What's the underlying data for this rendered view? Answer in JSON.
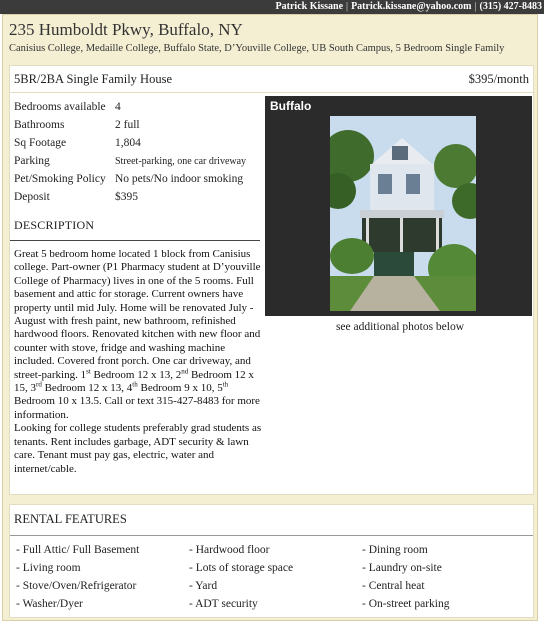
{
  "contact": {
    "name": "Patrick Kissane",
    "email": "Patrick.kissane@yahoo.com",
    "phone": "(315) 427-8483"
  },
  "listing": {
    "title": "235 Humboldt Pkwy, Buffalo, NY",
    "subtitle": "Canisius College, Medaille College, Buffalo State, D’Youville College, UB South Campus,  5 Bedroom Single Family",
    "summary": "5BR/2BA Single Family House",
    "rent": "$395/month"
  },
  "details": [
    {
      "label": "Bedrooms available",
      "value": "4"
    },
    {
      "label": "Bathrooms",
      "value": "2 full"
    },
    {
      "label": "Sq Footage",
      "value": "1,804"
    },
    {
      "label": "Parking",
      "value": "Street-parking, one car driveway"
    },
    {
      "label": "Pet/Smoking Policy",
      "value": "No pets/No indoor smoking"
    },
    {
      "label": "Deposit",
      "value": "$395"
    }
  ],
  "description": {
    "heading": "DESCRIPTION",
    "p1": "Great 5 bedroom home located 1 block from Canisius college. Part-owner (P1 Pharmacy student at D’youville College of Pharmacy) lives in one of the 5 rooms. Full basement and attic for storage. Current owners have property until mid July. Home will be renovated July - August with fresh paint, new bathroom, refinished hardwood floors. Renovated kitchen with new floor and counter with stove, fridge and washing machine included. Covered front porch. One car driveway, and street-parking. 1",
    "sup1": "st",
    "s1": " Bedroom 12 x 13, 2",
    "sup2": "nd",
    "s2": " Bedroom 12 x 15, 3",
    "sup3": "rd",
    "s3": " Bedroom 12 x 13, 4",
    "sup4": "th",
    "s4": " Bedroom 9 x 10, 5",
    "sup5": "th",
    "s5": " Bedroom 10 x 13.5. Call or text 315-427-8483 for more information.",
    "p2": "Looking for college students preferably grad students as tenants. Rent includes garbage, ADT security & lawn care. Tenant must pay gas, electric, water and internet/cable."
  },
  "photo": {
    "label": "Buffalo",
    "caption": "see additional photos below"
  },
  "rental_features": {
    "heading": "RENTAL FEATURES",
    "col1": [
      "- Full Attic/ Full Basement",
      "- Living room",
      "- Stove/Oven/Refrigerator",
      "- Washer/Dyer"
    ],
    "col2": [
      "- Hardwood floor",
      "- Lots of storage space",
      "- Yard",
      "- ADT security"
    ],
    "col3": [
      "- Dining room",
      "- Laundry on-site",
      "- Central heat",
      "- On-street parking"
    ]
  }
}
